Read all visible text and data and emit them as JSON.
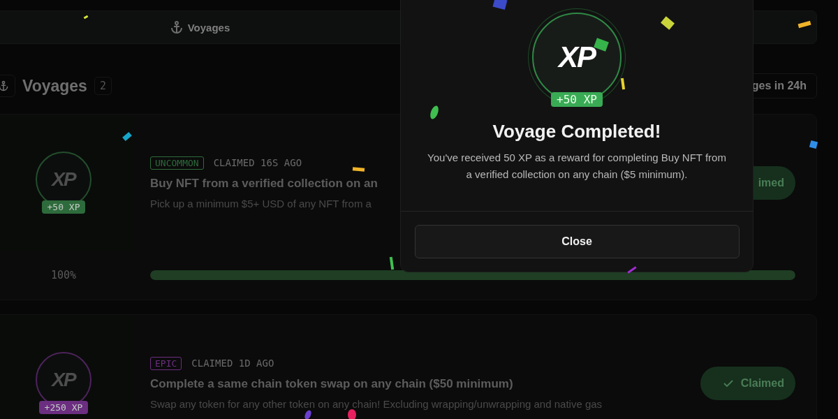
{
  "nav": {
    "tabs": [
      {
        "label": "Voyages",
        "selected": true
      }
    ]
  },
  "header": {
    "title": "Voyages",
    "count": "2",
    "stat": "ges in 24h"
  },
  "voyages": [
    {
      "rarity": "UNCOMMON",
      "color": "#2e6b3c",
      "claimed": "CLAIMED 16S AGO",
      "title": "Buy NFT from a verified collection on an",
      "description": "Pick up a minimum $5+ USD of any NFT from a",
      "logo": "XP",
      "xp": "+50 XP",
      "percent": "100%",
      "level": 1,
      "button": "imed"
    },
    {
      "rarity": "EPIC",
      "color": "#6b2e80",
      "claimed": "CLAIMED 1D AGO",
      "title": "Complete a same chain token swap on any chain ($50 minimum)",
      "description": "Swap any token for any other token on any chain! Excluding wrapping/unwrapping and native gas",
      "logo": "XP",
      "xp": "+250 XP",
      "button": "Claimed",
      "check": true
    }
  ],
  "modal": {
    "logo": "XP",
    "badge": "+50 XP",
    "title": "Voyage Completed!",
    "message": "You've received 50 XP as a reward for completing Buy NFT from a verified collection on any chain ($5 minimum).",
    "button": "Close"
  }
}
